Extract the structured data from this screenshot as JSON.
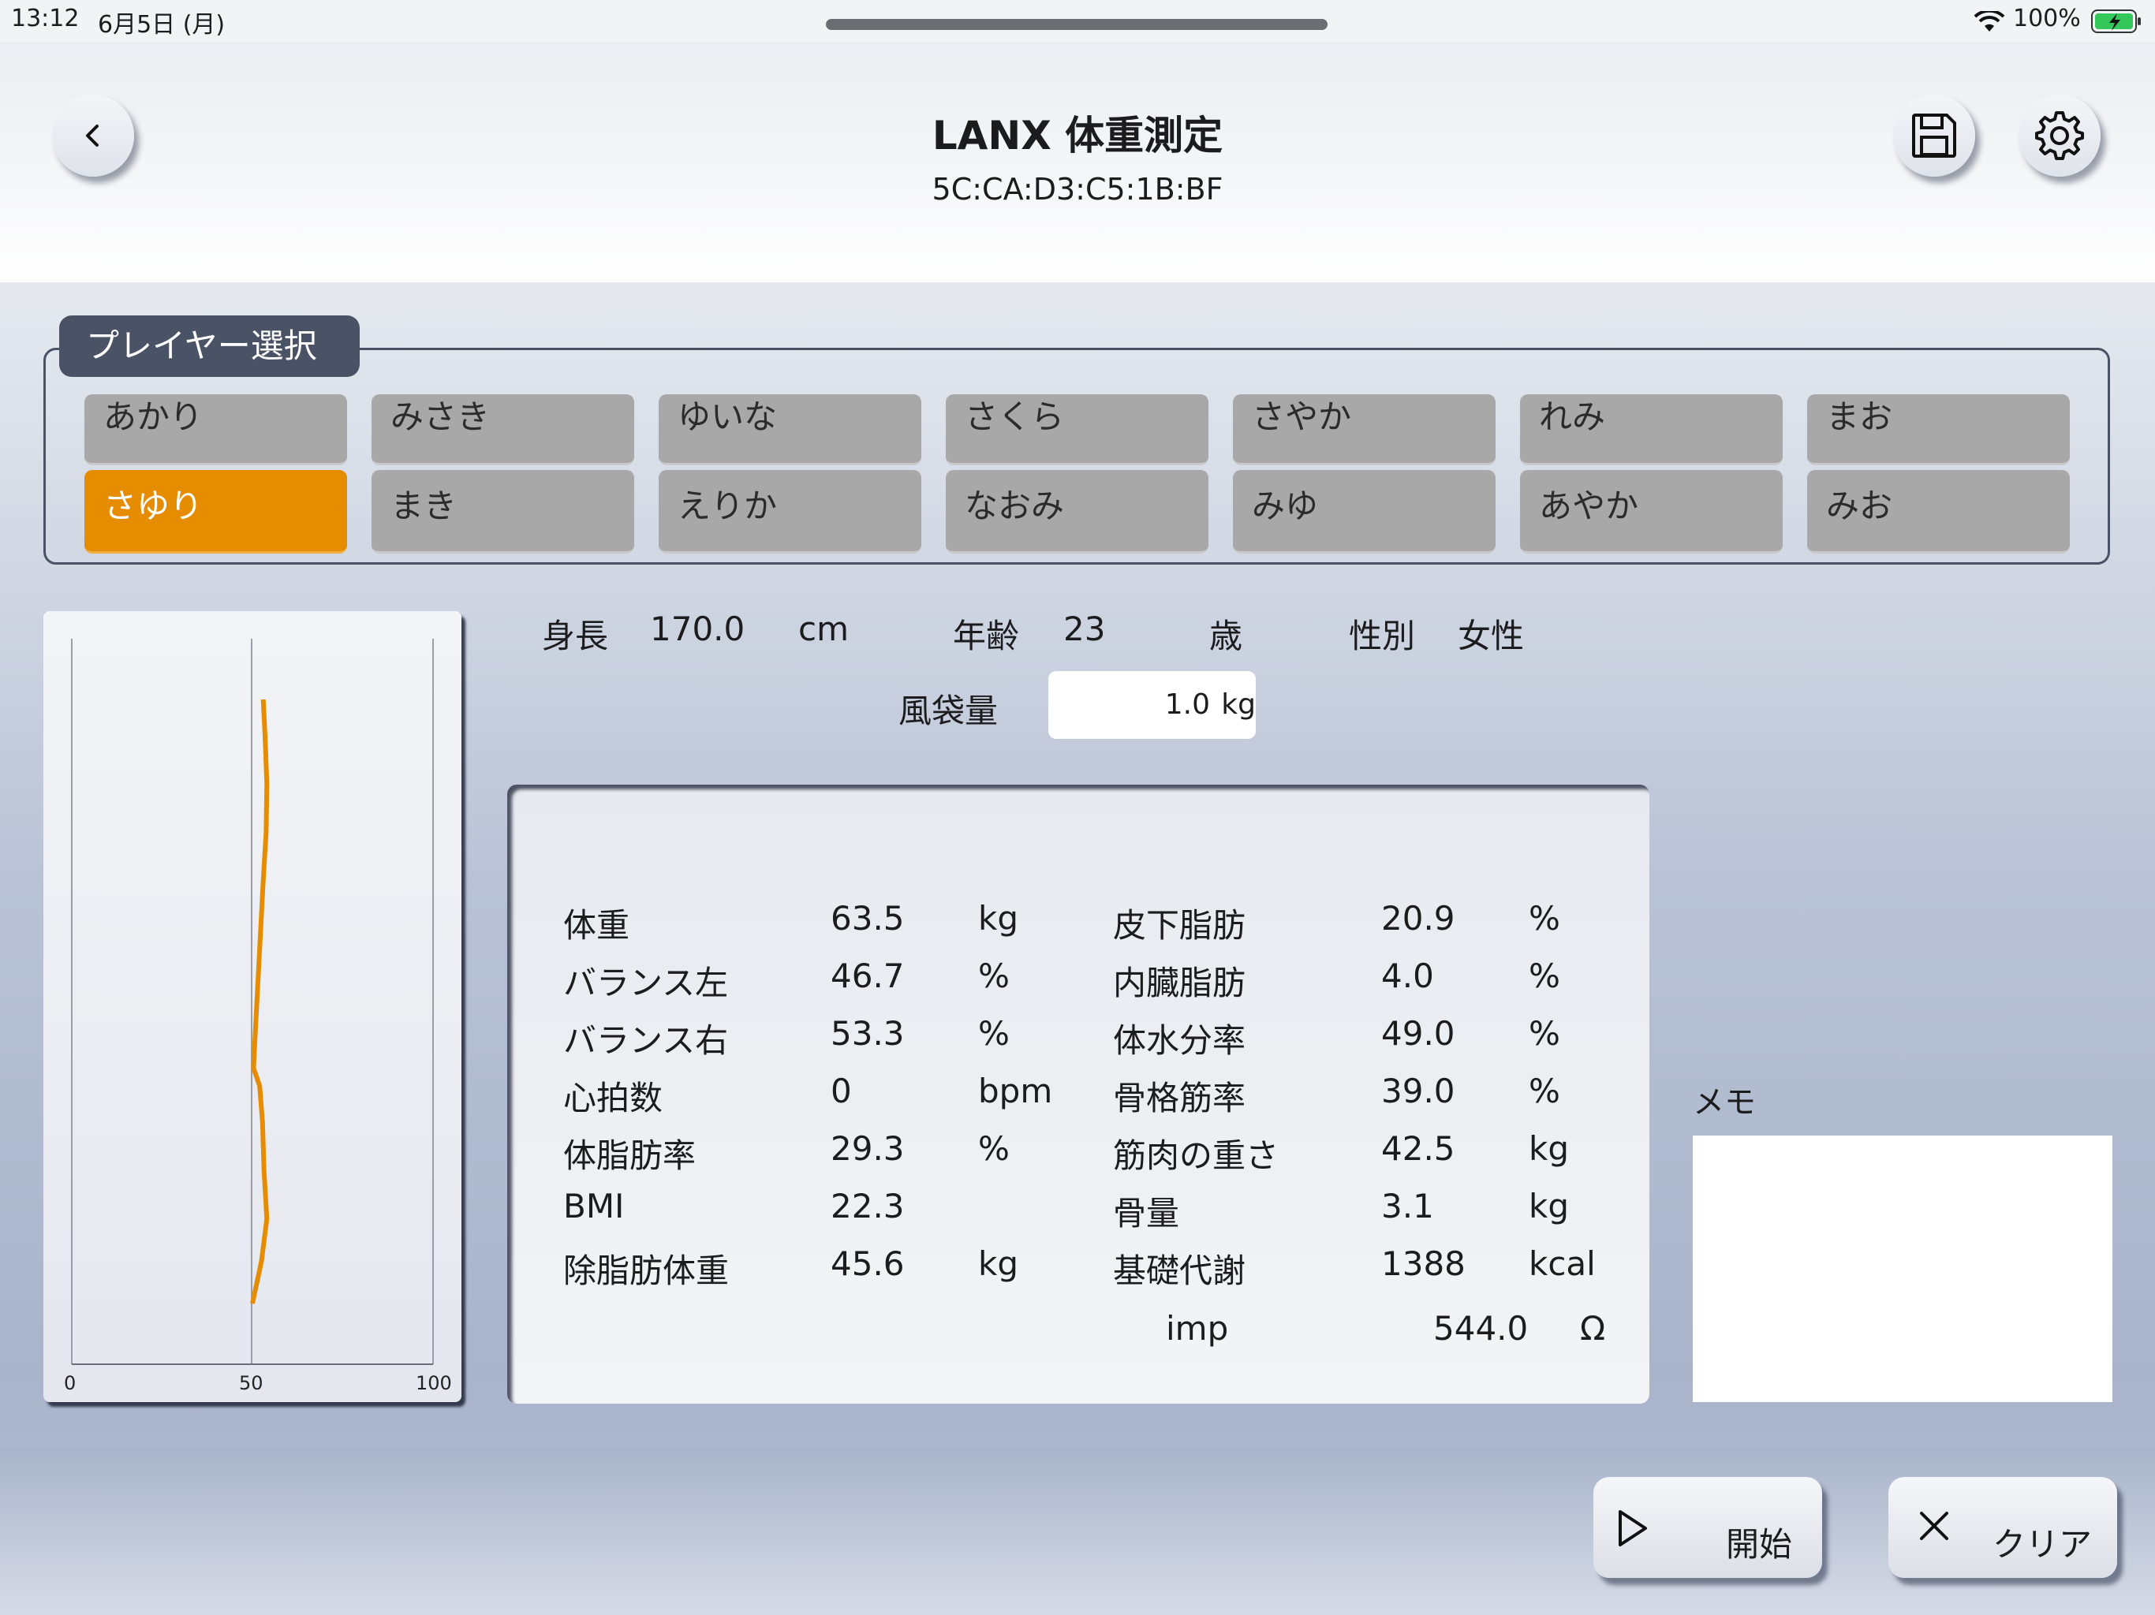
{
  "status_bar": {
    "time": "13:12",
    "date": "6月5日 (月)",
    "battery": "100%"
  },
  "header": {
    "title": "LANX 体重測定",
    "device_address": "5C:CA:D3:C5:1B:BF"
  },
  "player_select": {
    "label": "プレイヤー選択",
    "row1": [
      "あかり",
      "みさき",
      "ゆいな",
      "さくら",
      "さやか",
      "れみ",
      "まお"
    ],
    "row2": [
      "さゆり",
      "まき",
      "えりか",
      "なおみ",
      "みゆ",
      "あやか",
      "みお"
    ],
    "selected": "さゆり"
  },
  "balance_chart": {
    "x_ticks": [
      "0",
      "50",
      "100"
    ],
    "line_color": "#e58c00"
  },
  "chart_data": {
    "type": "line",
    "xlim": [
      0,
      100
    ],
    "x": [
      53,
      53.5,
      54,
      53.8,
      53,
      52.3,
      51.6,
      50.8,
      50.3,
      52,
      52.8,
      53.2,
      54,
      52.5,
      50
    ],
    "y": [
      0,
      6,
      14,
      22,
      30,
      38,
      46,
      55,
      61,
      64,
      70,
      78,
      86,
      93,
      100
    ]
  },
  "profile": {
    "height_label": "身長",
    "height_value": "170.0",
    "height_unit": "cm",
    "age_label": "年齢",
    "age_value": "23",
    "age_unit": "歳",
    "sex_label": "性別",
    "sex_value": "女性",
    "airbag_label": "風袋量",
    "airbag_value": "1.0",
    "airbag_unit": "kg"
  },
  "results_left": [
    {
      "label": "体重",
      "value": "63.5",
      "unit": "kg"
    },
    {
      "label": "バランス左",
      "value": "46.7",
      "unit": "%"
    },
    {
      "label": "バランス右",
      "value": "53.3",
      "unit": "%"
    },
    {
      "label": "心拍数",
      "value": "0",
      "unit": "bpm"
    },
    {
      "label": "体脂肪率",
      "value": "29.3",
      "unit": "%"
    },
    {
      "label": "BMI",
      "value": "22.3",
      "unit": ""
    },
    {
      "label": "除脂肪体重",
      "value": "45.6",
      "unit": "kg"
    }
  ],
  "results_right": [
    {
      "label": "皮下脂肪",
      "value": "20.9",
      "unit": "%"
    },
    {
      "label": "内臓脂肪",
      "value": "4.0",
      "unit": "%"
    },
    {
      "label": "体水分率",
      "value": "49.0",
      "unit": "%"
    },
    {
      "label": "骨格筋率",
      "value": "39.0",
      "unit": "%"
    },
    {
      "label": "筋肉の重さ",
      "value": "42.5",
      "unit": "kg"
    },
    {
      "label": "骨量",
      "value": "3.1",
      "unit": "kg"
    },
    {
      "label": "基礎代謝",
      "value": "1388",
      "unit": "kcal"
    }
  ],
  "impedance": {
    "label": "imp",
    "value": "544.0",
    "unit": "Ω"
  },
  "memo": {
    "label": "メモ",
    "value": ""
  },
  "footer": {
    "start_label": "開始",
    "clear_label": "クリア"
  }
}
